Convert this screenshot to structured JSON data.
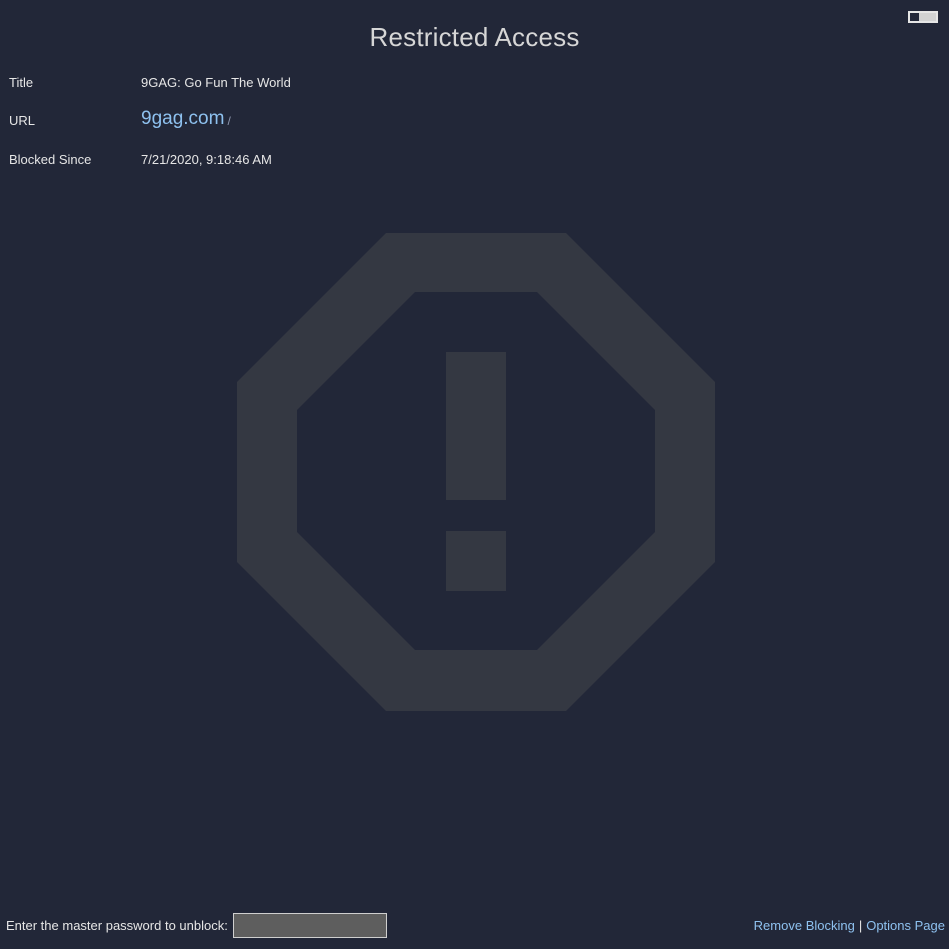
{
  "header": {
    "title": "Restricted Access",
    "toggle_icon": "toggle-switch-icon"
  },
  "info": {
    "title_label": "Title",
    "title_value": "9GAG: Go Fun The World",
    "url_label": "URL",
    "url_host": "9gag.com",
    "url_path": "/",
    "since_label": "Blocked Since",
    "since_value": "7/21/2020, 9:18:46 AM"
  },
  "illustration": {
    "icon": "stop-warning-icon",
    "color": "#343842"
  },
  "footer": {
    "password_prompt": "Enter the master password to unblock:",
    "password_value": "",
    "remove_blocking": "Remove Blocking",
    "separator": "|",
    "options_page": "Options Page"
  },
  "colors": {
    "background": "#222738",
    "link": "#8ec1ef",
    "text": "#e6e6e6"
  }
}
